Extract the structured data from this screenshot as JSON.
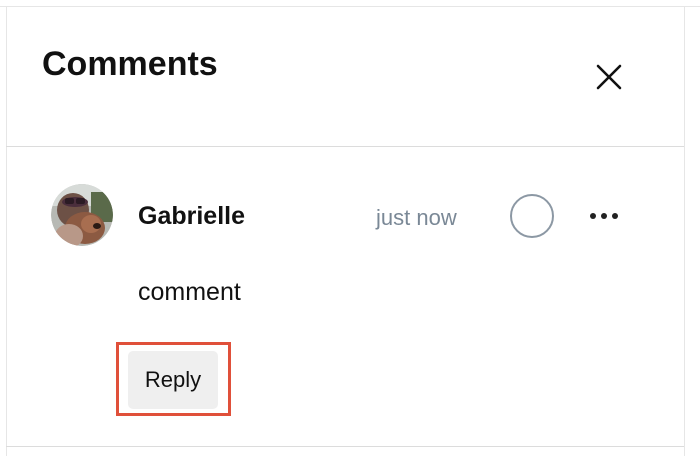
{
  "panel": {
    "title": "Comments",
    "close_icon": "close-icon"
  },
  "comment": {
    "author": "Gabrielle",
    "timestamp": "just now",
    "body": "comment",
    "avatar_icon": "avatar",
    "resolve_icon": "circle-icon",
    "more_icon": "more-horizontal-icon",
    "reply_label": "Reply"
  },
  "colors": {
    "highlight": "#e0503a",
    "timestamp": "#7a8896",
    "reply_bg": "#efefef"
  }
}
